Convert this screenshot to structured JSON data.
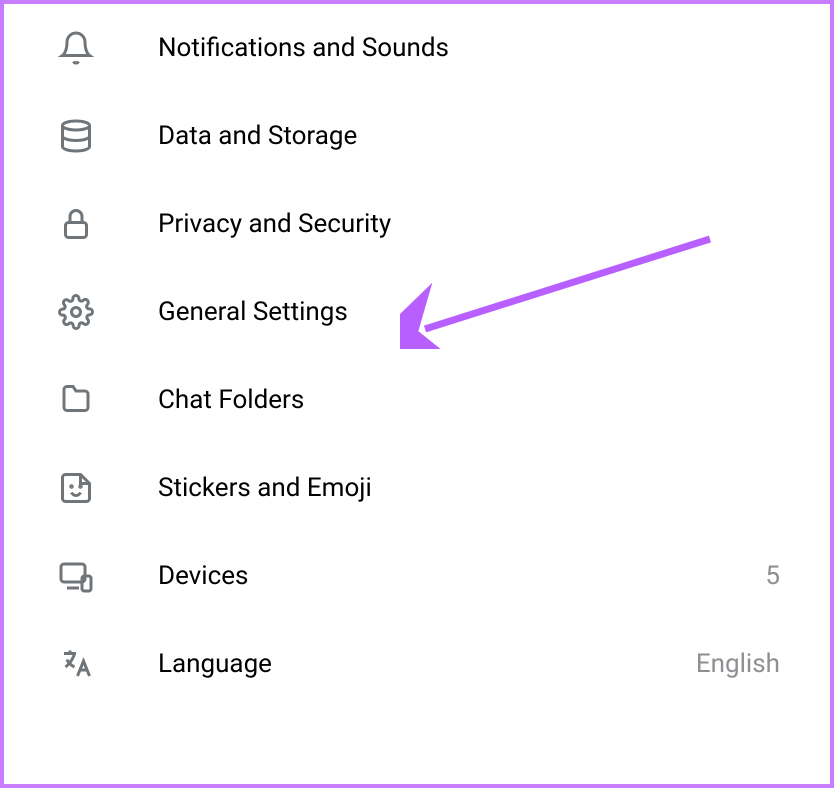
{
  "settings": {
    "items": [
      {
        "label": "Notifications and Sounds",
        "icon": "bell"
      },
      {
        "label": "Data and Storage",
        "icon": "database"
      },
      {
        "label": "Privacy and Security",
        "icon": "lock"
      },
      {
        "label": "General Settings",
        "icon": "gear"
      },
      {
        "label": "Chat Folders",
        "icon": "folder"
      },
      {
        "label": "Stickers and Emoji",
        "icon": "sticker"
      },
      {
        "label": "Devices",
        "icon": "devices",
        "value": "5"
      },
      {
        "label": "Language",
        "icon": "language",
        "value": "English"
      }
    ]
  },
  "annotation_color": "#b860ff"
}
